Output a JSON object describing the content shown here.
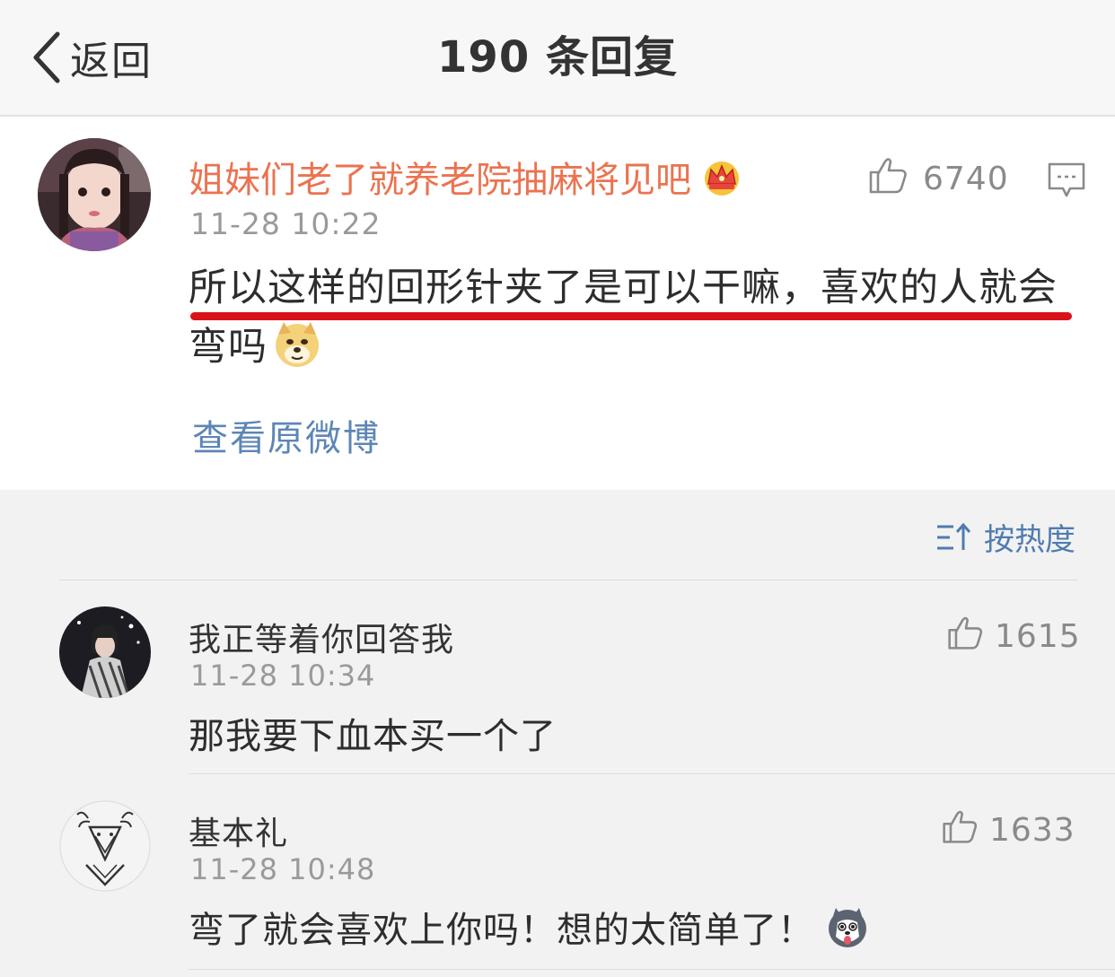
{
  "nav": {
    "back_label": "返回",
    "title": "190 条回复"
  },
  "main_comment": {
    "username": "姐妹们老了就养老院抽麻将见吧",
    "time": "11-28 10:22",
    "like_count": "6740",
    "text": "所以这样的回形针夹了是可以干嘛，喜欢的人就会弯吗",
    "view_original": "查看原微博",
    "username_color": "#eb7350",
    "highlight_color": "#d9121a"
  },
  "sort": {
    "label": "按热度"
  },
  "replies": [
    {
      "username": "我正等着你回答我",
      "time": "11-28 10:34",
      "text": "那我要下血本买一个了",
      "like_count": "1615"
    },
    {
      "username": "基本礼",
      "time": "11-28 10:48",
      "text": "弯了就会喜欢上你吗！想的太简单了！",
      "like_count": "1633"
    }
  ],
  "icons": {
    "back": "chevron-left-icon",
    "like": "thumbs-up-icon",
    "comment": "comment-icon",
    "sort": "sort-icon",
    "badge": "crown-icon",
    "emoji_1": "doge-emoji-icon",
    "emoji_2": "husky-emoji-icon"
  }
}
